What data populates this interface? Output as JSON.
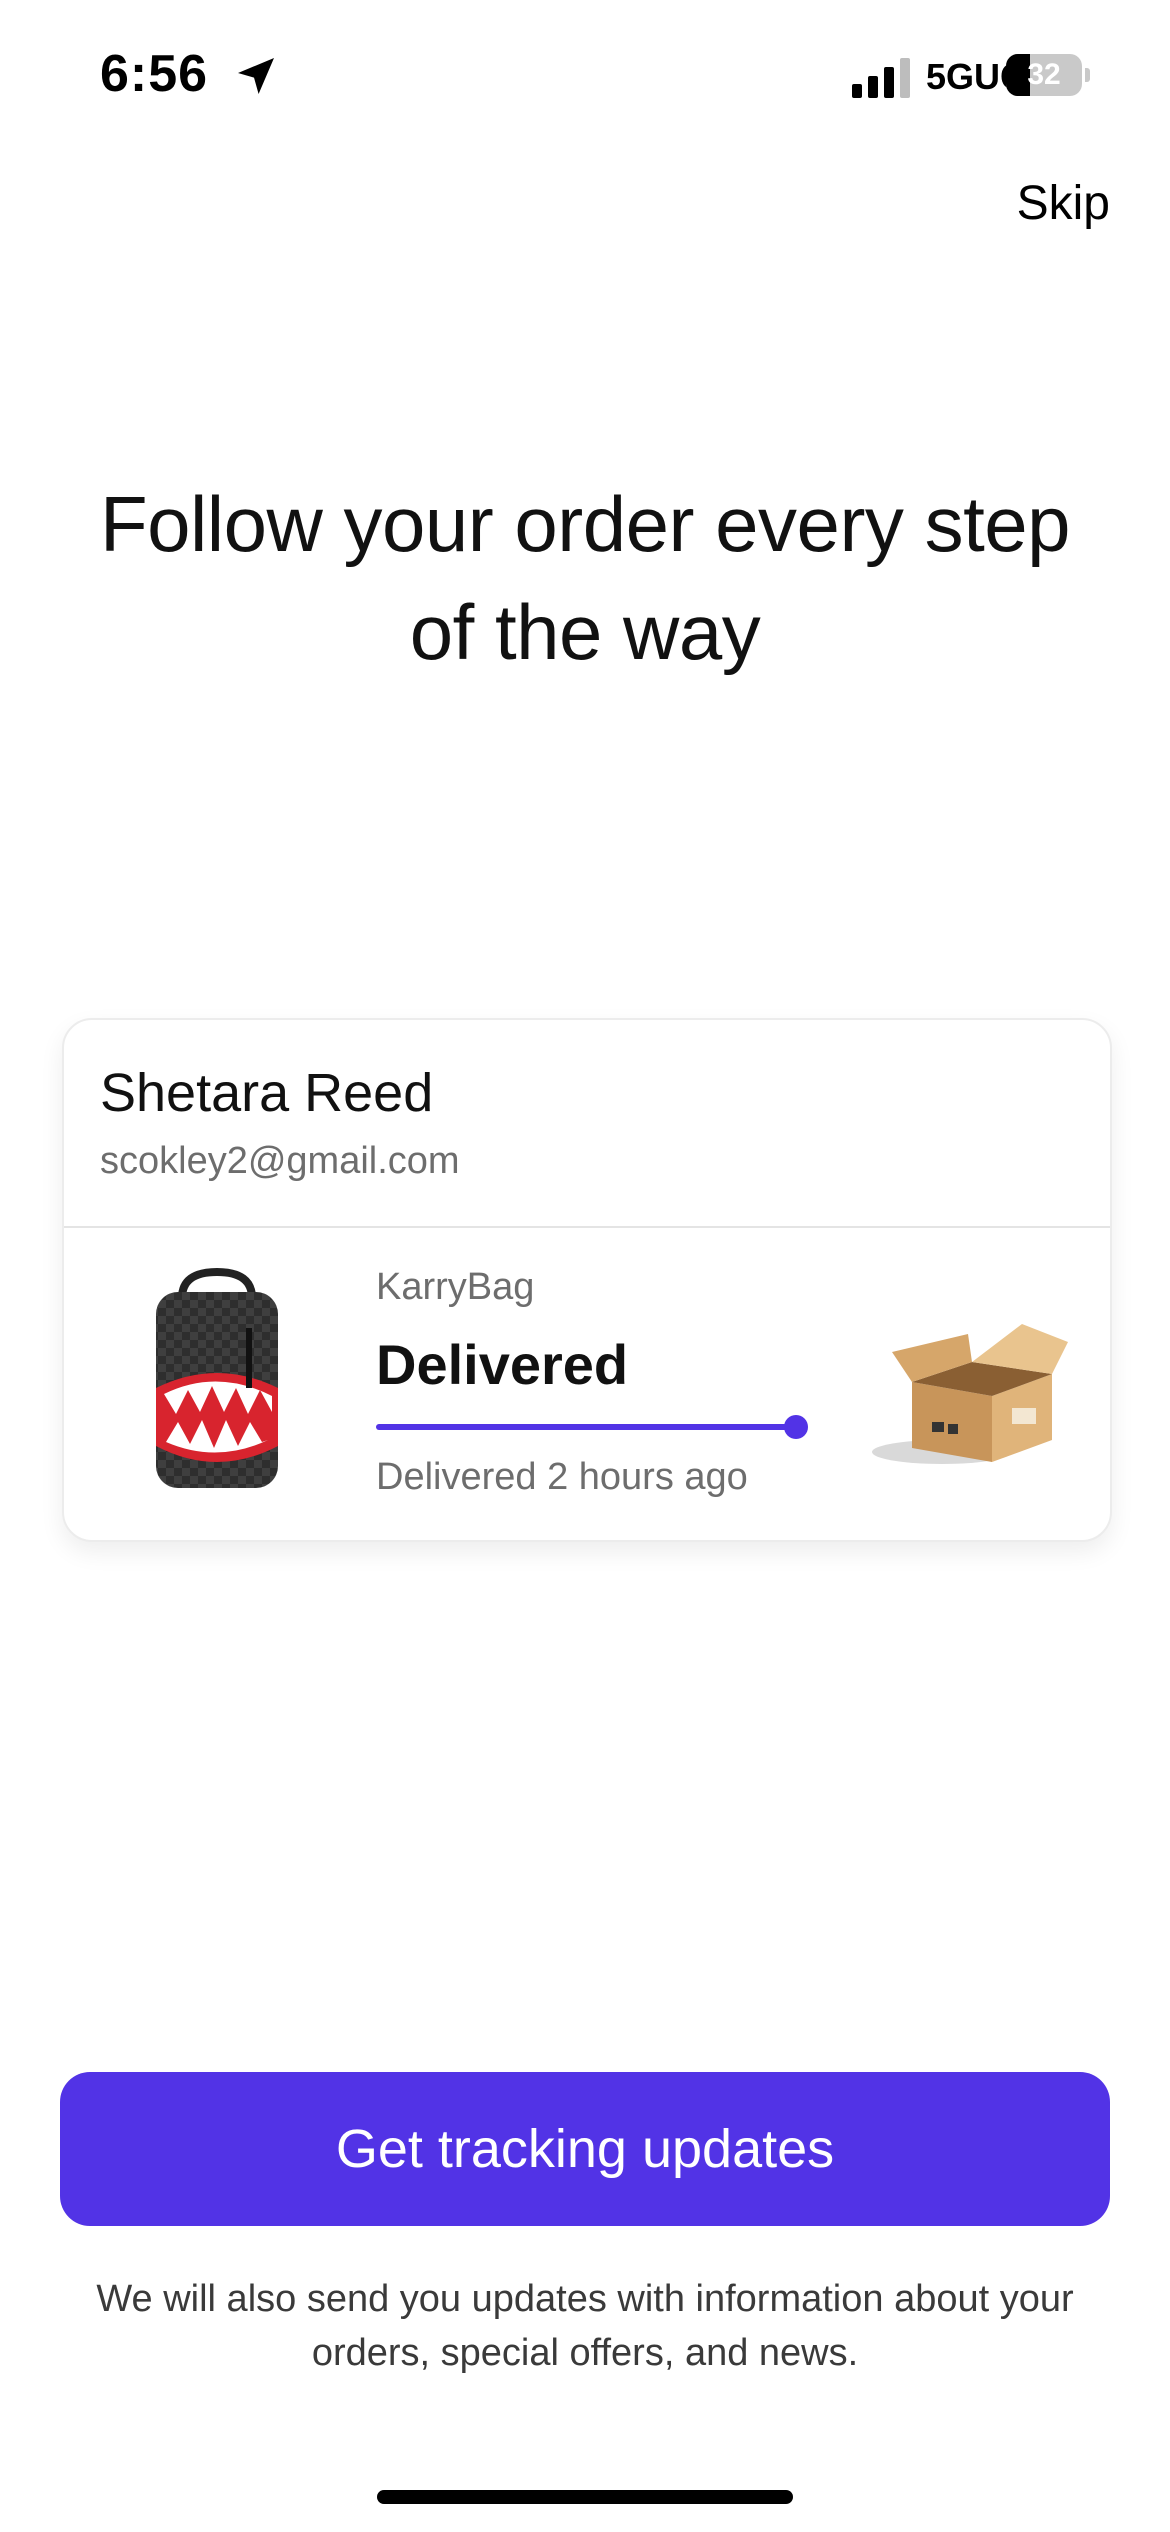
{
  "status_bar": {
    "time": "6:56",
    "network": "5GUC",
    "battery_level": "32",
    "battery_fraction": 0.32
  },
  "icons": {
    "location": "location-arrow-icon",
    "signal": "cellular-signal-icon",
    "battery": "battery-icon",
    "product": "backpack-image",
    "package": "open-box-image"
  },
  "header": {
    "skip_label": "Skip"
  },
  "headline": "Follow your order every step of the way",
  "order_card": {
    "customer_name": "Shetara Reed",
    "customer_email": "scokley2@gmail.com",
    "brand": "KarryBag",
    "status": "Delivered",
    "status_detail": "Delivered 2 hours ago",
    "progress": 1.0
  },
  "cta": {
    "label": "Get tracking updates"
  },
  "disclaimer": "We will also send you updates with information about your orders, special offers, and news.",
  "colors": {
    "accent": "#5233e6",
    "text_primary": "#111111",
    "text_secondary": "#6d6d6d",
    "card_border": "#e4e4e4",
    "background": "#ffffff"
  }
}
